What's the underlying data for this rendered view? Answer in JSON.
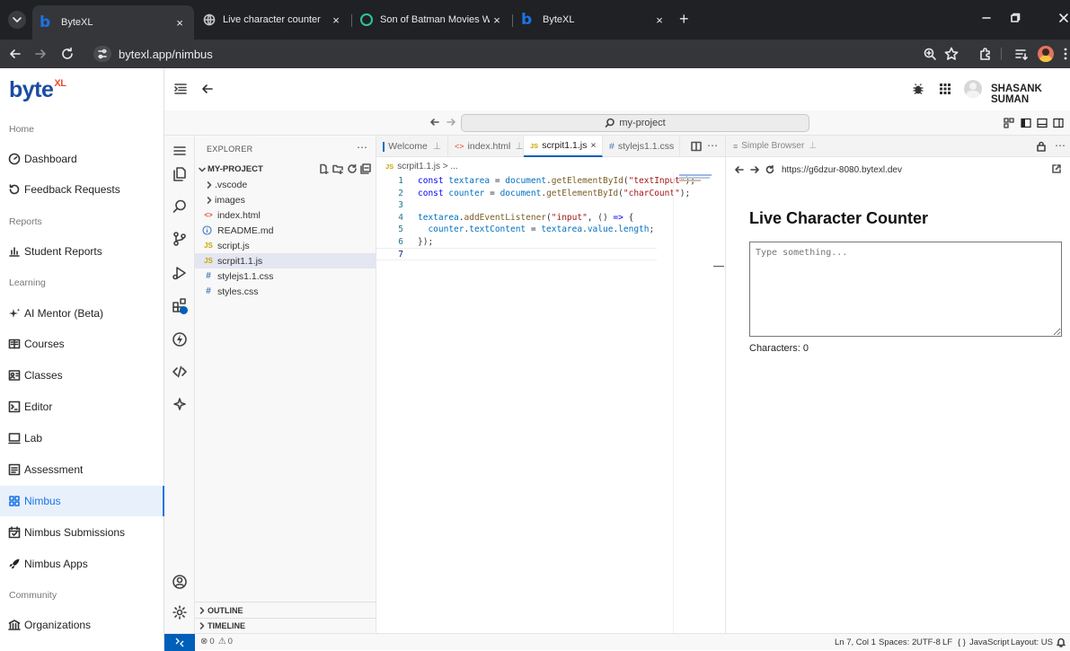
{
  "browser": {
    "tabs": [
      {
        "title": "ByteXL",
        "icon": "bytexl-favicon",
        "active": true
      },
      {
        "title": "Live character counter",
        "icon": "globe-icon",
        "active": false
      },
      {
        "title": "Son of Batman Movies Watch F",
        "icon": "movie-site-favicon",
        "active": false
      },
      {
        "title": "ByteXL",
        "icon": "bytexl-favicon",
        "active": false
      }
    ],
    "address": "bytexl.app/nimbus"
  },
  "sidebar": {
    "logo_main": "byte",
    "logo_sup": "XL",
    "sections": [
      {
        "title": "Home",
        "items": [
          {
            "label": "Dashboard",
            "icon": "dashboard-icon"
          },
          {
            "label": "Feedback Requests",
            "icon": "feedback-icon"
          }
        ]
      },
      {
        "title": "Reports",
        "items": [
          {
            "label": "Student Reports",
            "icon": "chart-icon"
          }
        ]
      },
      {
        "title": "Learning",
        "items": [
          {
            "label": "AI Mentor (Beta)",
            "icon": "sparkle-icon"
          },
          {
            "label": "Courses",
            "icon": "book-icon"
          },
          {
            "label": "Classes",
            "icon": "classes-icon"
          },
          {
            "label": "Editor",
            "icon": "terminal-icon"
          },
          {
            "label": "Lab",
            "icon": "monitor-icon"
          },
          {
            "label": "Assessment",
            "icon": "assessment-icon"
          },
          {
            "label": "Nimbus",
            "icon": "nimbus-icon",
            "selected": true
          },
          {
            "label": "Nimbus Submissions",
            "icon": "calendar-icon"
          },
          {
            "label": "Nimbus Apps",
            "icon": "rocket-icon"
          }
        ]
      },
      {
        "title": "Community",
        "items": [
          {
            "label": "Organizations",
            "icon": "bank-icon"
          }
        ]
      }
    ]
  },
  "header": {
    "user_name": "SHASANK SUMAN"
  },
  "vscode": {
    "command_center": "my-project",
    "explorer": {
      "title": "EXPLORER",
      "project": "MY-PROJECT",
      "items": [
        {
          "name": ".vscode",
          "type": "folder"
        },
        {
          "name": "images",
          "type": "folder"
        },
        {
          "name": "index.html",
          "type": "html"
        },
        {
          "name": "README.md",
          "type": "info"
        },
        {
          "name": "script.js",
          "type": "js"
        },
        {
          "name": "scrpit1.1.js",
          "type": "js",
          "selected": true
        },
        {
          "name": "stylejs1.1.css",
          "type": "css"
        },
        {
          "name": "styles.css",
          "type": "css"
        }
      ],
      "outline": "OUTLINE",
      "timeline": "TIMELINE"
    },
    "editor_tabs": [
      {
        "label": "Welcome",
        "icon": "vscode-icon"
      },
      {
        "label": "index.html",
        "icon": "html-icon"
      },
      {
        "label": "scrpit1.1.js",
        "icon": "js-icon",
        "active": true
      },
      {
        "label": "stylejs1.1.css",
        "icon": "css-icon"
      }
    ],
    "breadcrumb": "scrpit1.1.js > ...",
    "code": [
      {
        "n": "1",
        "text": "const textarea = document.getElementById(\"textInput\");"
      },
      {
        "n": "2",
        "text": "const counter = document.getElementById(\"charCount\");"
      },
      {
        "n": "3",
        "text": ""
      },
      {
        "n": "4",
        "text": "textarea.addEventListener(\"input\", () => {"
      },
      {
        "n": "5",
        "text": "  counter.textContent = textarea.value.length;"
      },
      {
        "n": "6",
        "text": "});"
      },
      {
        "n": "7",
        "text": ""
      }
    ],
    "simple_browser": {
      "tab": "Simple Browser",
      "url": "https://g6dzur-8080.bytexl.dev",
      "heading": "Live Character Counter",
      "placeholder": "Type something...",
      "count_text": "Characters: 0"
    },
    "status": {
      "errors": "0",
      "warnings": "0",
      "position": "Ln 7, Col 1",
      "spaces": "Spaces: 2",
      "encoding": "UTF-8",
      "eol": "LF",
      "language": "JavaScript",
      "layout": "Layout: US"
    }
  }
}
